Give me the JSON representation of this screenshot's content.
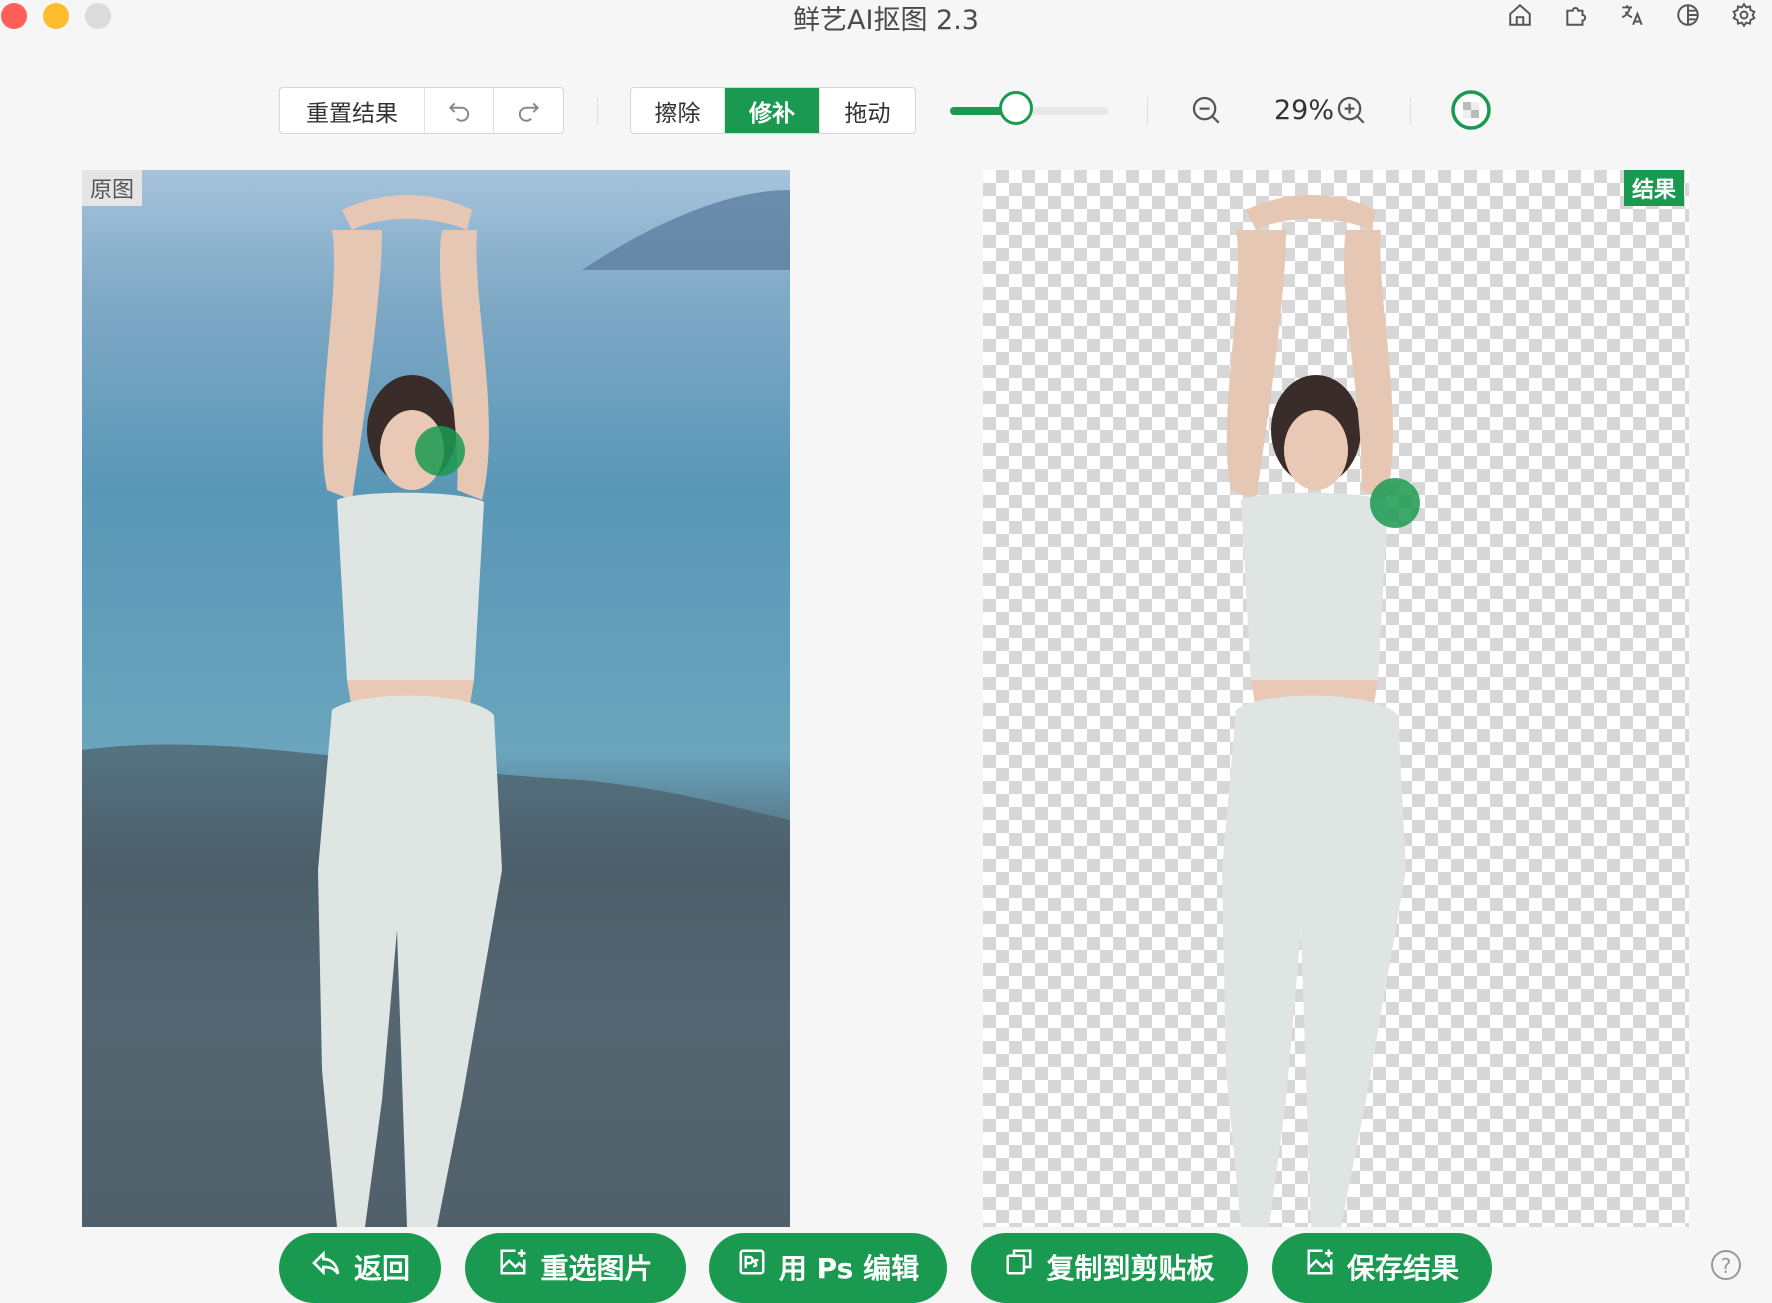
{
  "window": {
    "title": "鲜艺AI抠图 2.3"
  },
  "toolbar": {
    "reset_label": "重置结果",
    "modes": [
      {
        "label": "擦除",
        "active": false
      },
      {
        "label": "修补",
        "active": true
      },
      {
        "label": "拖动",
        "active": false
      }
    ],
    "brush_size_fraction": 0.42,
    "zoom_label": "29%"
  },
  "panes": {
    "original_label": "原图",
    "result_label": "结果"
  },
  "actions": {
    "back": "返回",
    "reselect": "重选图片",
    "ps_edit": "用 Ps 编辑",
    "copy": "复制到剪贴板",
    "save": "保存结果"
  },
  "help": "?",
  "colors": {
    "accent": "#1a9a51",
    "checker": "#d7d7d7"
  }
}
